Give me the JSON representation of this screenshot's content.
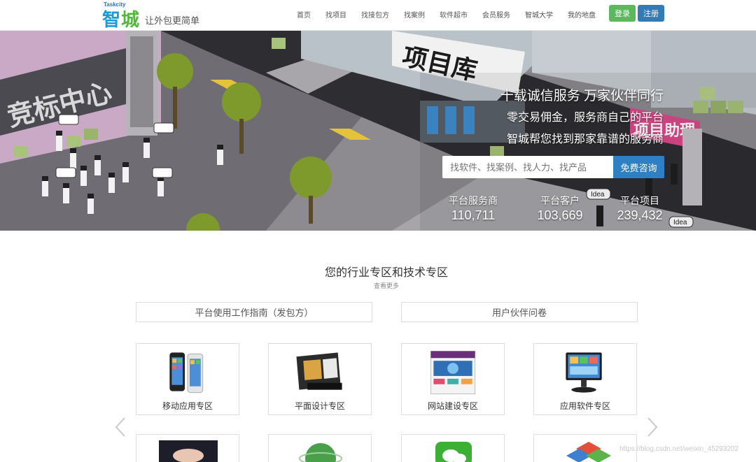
{
  "header": {
    "logo_tag": "Taskcity",
    "logo_char1": "智",
    "logo_char2": "城",
    "slogan": "让外包更简单",
    "nav": [
      "首页",
      "找项目",
      "找接包方",
      "找案例",
      "软件超市",
      "会员服务",
      "智城大学",
      "我的地盘"
    ],
    "login": "登录",
    "register": "注册"
  },
  "hero": {
    "sign_left": "竞标中心",
    "sign_center": "项目库",
    "sign_right": "项目助理",
    "line1": "十载诚信服务 万家伙伴同行",
    "line2": "零交易佣金，服务商自己的平台",
    "line3": "智城帮您找到那家靠谱的服务商",
    "search_placeholder": "找软件、找案例、找人力、找产品",
    "search_button": "免费咨询",
    "idea_label": "Idea",
    "stats": [
      {
        "label": "平台服务商",
        "value": "110,711"
      },
      {
        "label": "平台客户",
        "value": "103,669"
      },
      {
        "label": "平台项目",
        "value": "239,432"
      }
    ]
  },
  "section": {
    "title": "您的行业专区和技术专区",
    "more": "查看更多",
    "guide_left": "平台使用工作指南（发包方）",
    "guide_right": "用户伙伴问卷",
    "cards": [
      "移动应用专区",
      "平面设计专区",
      "网站建设专区",
      "应用软件专区"
    ]
  },
  "watermark": "https://blog.csdn.net/weixin_45293202",
  "colors": {
    "login_green": "#5cb85c",
    "register_blue": "#337ab7",
    "search_blue": "#2f7fc4",
    "logo_blue": "#1a9ad7",
    "logo_green": "#52b73a"
  },
  "icons": [
    "phone-icon",
    "design-icon",
    "website-icon",
    "monitor-icon",
    "hand-icon",
    "globe-icon",
    "wechat-icon",
    "puzzle-icon",
    "chevron-left-icon",
    "chevron-right-icon"
  ]
}
